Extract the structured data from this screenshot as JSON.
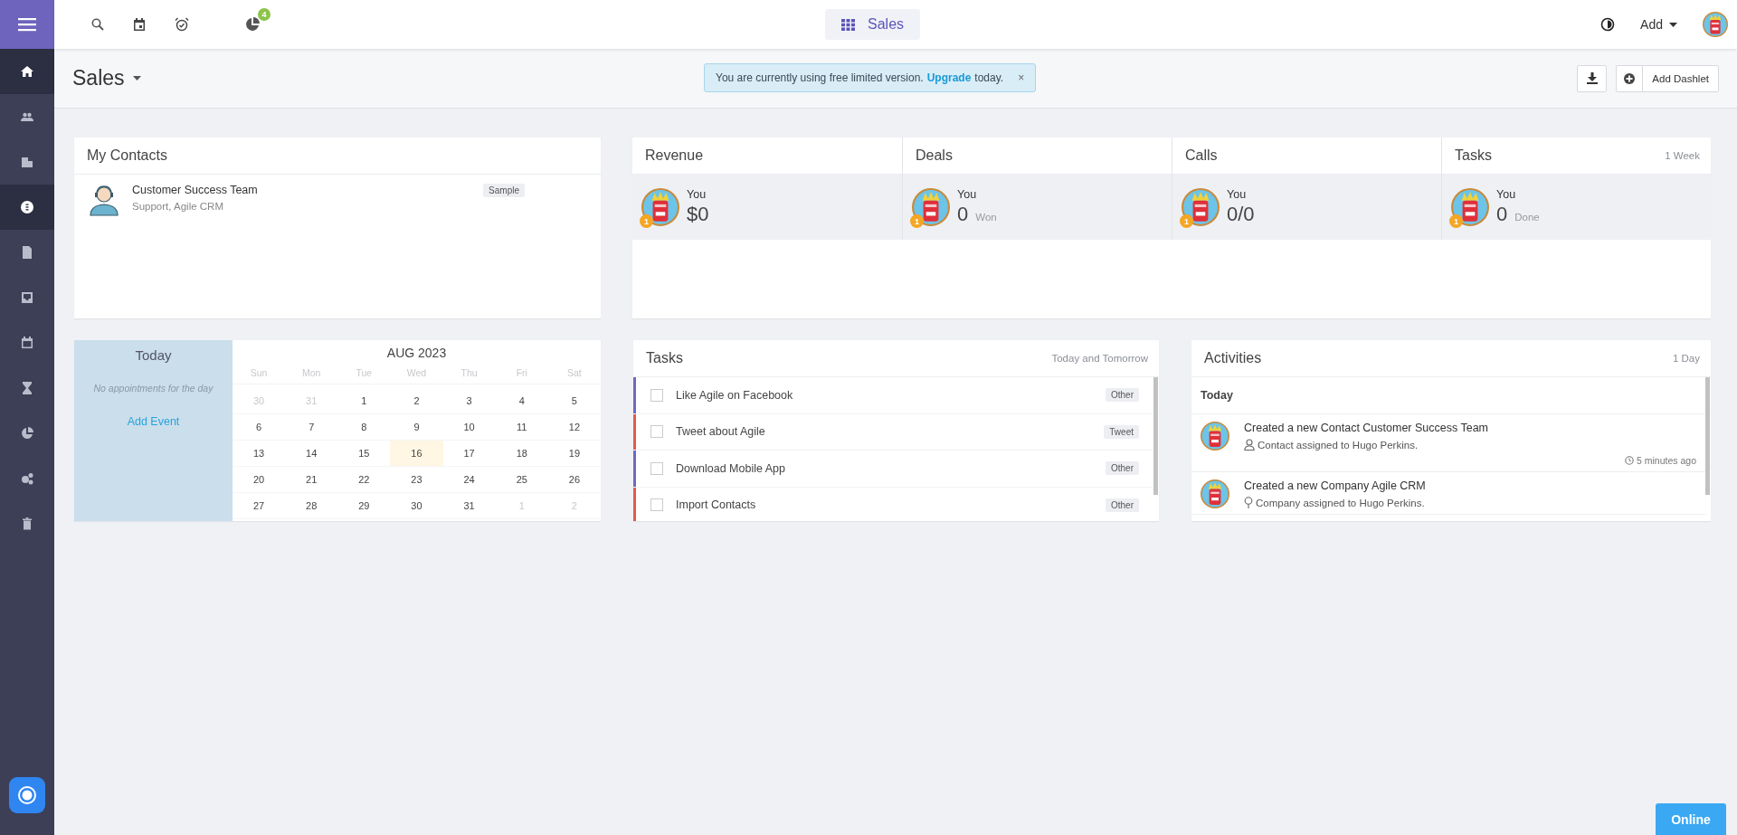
{
  "sidebar": {
    "items": [
      {
        "kind": "home",
        "selected": true
      },
      {
        "kind": "contacts",
        "selected": false
      },
      {
        "kind": "companies",
        "selected": false
      },
      {
        "kind": "deals",
        "selected": true
      },
      {
        "kind": "documents",
        "selected": false
      },
      {
        "kind": "inbox",
        "selected": false
      },
      {
        "kind": "calendar",
        "selected": false
      },
      {
        "kind": "hourglass",
        "selected": false
      },
      {
        "kind": "reports",
        "selected": false
      },
      {
        "kind": "automation",
        "selected": false
      },
      {
        "kind": "trash",
        "selected": false
      }
    ]
  },
  "topbar": {
    "notification_count": "4",
    "center_tab": {
      "label": "Sales",
      "selected": true
    },
    "add_menu": "Add"
  },
  "header": {
    "title": "Sales",
    "alert": {
      "text_before": "You are currently using free limited version.",
      "link": "Upgrade",
      "text_after": "today.",
      "close": "×"
    },
    "add_dashlet": "Add Dashlet"
  },
  "contacts": {
    "title": "My Contacts",
    "items": [
      {
        "name": "Customer Success Team",
        "subtitle": "Support, Agile CRM",
        "tag": "Sample"
      }
    ]
  },
  "stats": [
    {
      "title": "Revenue",
      "user": "You",
      "rank": "1",
      "value": "$0"
    },
    {
      "title": "Deals",
      "user": "You",
      "rank": "1",
      "value": "0",
      "unit": "Won"
    },
    {
      "title": "Calls",
      "user": "You",
      "rank": "1",
      "value": "0/0"
    },
    {
      "title": "Tasks",
      "range": "1 Week",
      "user": "You",
      "rank": "1",
      "value": "0",
      "unit": "Done"
    }
  ],
  "calendar": {
    "today_title": "Today",
    "empty": "No appointments for the day",
    "add_event": "Add Event",
    "month": "AUG 2023",
    "weekdays": [
      "Sun",
      "Mon",
      "Tue",
      "Wed",
      "Thu",
      "Fri",
      "Sat"
    ],
    "weeks": [
      [
        {
          "day": "30",
          "other_month": true,
          "selected": false
        },
        {
          "day": "31",
          "other_month": true,
          "selected": false
        },
        {
          "day": "1",
          "other_month": false,
          "selected": false
        },
        {
          "day": "2",
          "other_month": false,
          "selected": false
        },
        {
          "day": "3",
          "other_month": false,
          "selected": false
        },
        {
          "day": "4",
          "other_month": false,
          "selected": false
        },
        {
          "day": "5",
          "other_month": false,
          "selected": false
        }
      ],
      [
        {
          "day": "6",
          "other_month": false,
          "selected": false
        },
        {
          "day": "7",
          "other_month": false,
          "selected": false
        },
        {
          "day": "8",
          "other_month": false,
          "selected": false
        },
        {
          "day": "9",
          "other_month": false,
          "selected": false
        },
        {
          "day": "10",
          "other_month": false,
          "selected": false
        },
        {
          "day": "11",
          "other_month": false,
          "selected": false
        },
        {
          "day": "12",
          "other_month": false,
          "selected": false
        }
      ],
      [
        {
          "day": "13",
          "other_month": false,
          "selected": false
        },
        {
          "day": "14",
          "other_month": false,
          "selected": false
        },
        {
          "day": "15",
          "other_month": false,
          "selected": false
        },
        {
          "day": "16",
          "other_month": false,
          "selected": true
        },
        {
          "day": "17",
          "other_month": false,
          "selected": false
        },
        {
          "day": "18",
          "other_month": false,
          "selected": false
        },
        {
          "day": "19",
          "other_month": false,
          "selected": false
        }
      ],
      [
        {
          "day": "20",
          "other_month": false,
          "selected": false
        },
        {
          "day": "21",
          "other_month": false,
          "selected": false
        },
        {
          "day": "22",
          "other_month": false,
          "selected": false
        },
        {
          "day": "23",
          "other_month": false,
          "selected": false
        },
        {
          "day": "24",
          "other_month": false,
          "selected": false
        },
        {
          "day": "25",
          "other_month": false,
          "selected": false
        },
        {
          "day": "26",
          "other_month": false,
          "selected": false
        }
      ],
      [
        {
          "day": "27",
          "other_month": false,
          "selected": false
        },
        {
          "day": "28",
          "other_month": false,
          "selected": false
        },
        {
          "day": "29",
          "other_month": false,
          "selected": false
        },
        {
          "day": "30",
          "other_month": false,
          "selected": false
        },
        {
          "day": "31",
          "other_month": false,
          "selected": false
        },
        {
          "day": "1",
          "other_month": true,
          "selected": false
        },
        {
          "day": "2",
          "other_month": true,
          "selected": false
        }
      ]
    ]
  },
  "tasks": {
    "title": "Tasks",
    "range": "Today and Tomorrow",
    "items": [
      {
        "label": "Like Agile on Facebook",
        "tag": "Other",
        "color": "#6f69c2",
        "checked": false
      },
      {
        "label": "Tweet about Agile",
        "tag": "Tweet",
        "color": "#e8594a",
        "checked": false
      },
      {
        "label": "Download Mobile App",
        "tag": "Other",
        "color": "#6f69c2",
        "checked": false
      },
      {
        "label": "Import Contacts",
        "tag": "Other",
        "color": "#e8594a",
        "checked": false
      }
    ]
  },
  "activities": {
    "title": "Activities",
    "range": "1 Day",
    "group": "Today",
    "items": [
      {
        "kind": "contact",
        "title": "Created a new Contact Customer Success Team",
        "detail": "Contact assigned to Hugo Perkins.",
        "time": "5 minutes ago"
      },
      {
        "kind": "company",
        "title": "Created a new Company Agile CRM",
        "detail": "Company assigned to Hugo Perkins."
      }
    ]
  },
  "online": "Online"
}
